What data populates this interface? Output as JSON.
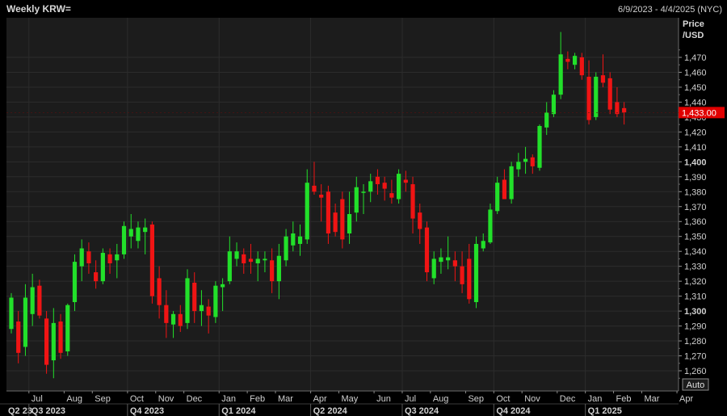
{
  "header": {
    "title": "Weekly KRW=",
    "range": "6/9/2023 - 4/4/2025 (NYC)"
  },
  "axis": {
    "price_label_line1": "Price",
    "price_label_line2": "/USD",
    "auto_label": "Auto"
  },
  "colors": {
    "background": "#000000",
    "plot_bg": "#1c1c1c",
    "up": "#22e02a",
    "down": "#f01414",
    "grid": "#2c2c2c",
    "text": "#d0d0d0",
    "last_badge": "#e00000"
  },
  "chart_data": {
    "type": "candlestick",
    "title": "Weekly KRW=",
    "subtitle": "6/9/2023 - 4/4/2025 (NYC)",
    "ylim": [
      1250,
      1490
    ],
    "y_ticks": [
      1260,
      1270,
      1280,
      1290,
      1300,
      1310,
      1320,
      1330,
      1340,
      1350,
      1360,
      1370,
      1380,
      1390,
      1400,
      1410,
      1420,
      1430,
      1440,
      1450,
      1460,
      1470
    ],
    "y_tick_labels": [
      "1,260",
      "1,270",
      "1,280",
      "1,290",
      "1,300",
      "1,310",
      "1,320",
      "1,330",
      "1,340",
      "1,350",
      "1,360",
      "1,370",
      "1,380",
      "1,390",
      "1,400",
      "1,410",
      "1,420",
      "1,430",
      "1,440",
      "1,450",
      "1,460",
      "1,470"
    ],
    "y_bold_ticks": [
      1300,
      1400
    ],
    "last_price": 1433,
    "last_price_label": "1,433.00",
    "month_labels": [
      {
        "label": "Jul",
        "week": 3
      },
      {
        "label": "Aug",
        "week": 8
      },
      {
        "label": "Sep",
        "week": 12
      },
      {
        "label": "Oct",
        "week": 17
      },
      {
        "label": "Nov",
        "week": 21
      },
      {
        "label": "Dec",
        "week": 25
      },
      {
        "label": "Jan",
        "week": 30
      },
      {
        "label": "Feb",
        "week": 34
      },
      {
        "label": "Mar",
        "week": 38
      },
      {
        "label": "Apr",
        "week": 43
      },
      {
        "label": "May",
        "week": 47
      },
      {
        "label": "Jun",
        "week": 52
      },
      {
        "label": "Jul",
        "week": 56
      },
      {
        "label": "Aug",
        "week": 60
      },
      {
        "label": "Sep",
        "week": 65
      },
      {
        "label": "Oct",
        "week": 69
      },
      {
        "label": "Nov",
        "week": 73
      },
      {
        "label": "Dec",
        "week": 78
      },
      {
        "label": "Jan",
        "week": 82
      },
      {
        "label": "Feb",
        "week": 86
      },
      {
        "label": "Mar",
        "week": 90
      },
      {
        "label": "Apr",
        "week": 95
      }
    ],
    "quarter_labels": [
      {
        "label": "Q2 23",
        "week": -1
      },
      {
        "label": "Q3 2023",
        "week": 3
      },
      {
        "label": "Q4 2023",
        "week": 17
      },
      {
        "label": "Q1 2024",
        "week": 30
      },
      {
        "label": "Q2 2024",
        "week": 43
      },
      {
        "label": "Q3 2024",
        "week": 56
      },
      {
        "label": "Q4 2024",
        "week": 69
      },
      {
        "label": "Q1 2025",
        "week": 82
      }
    ],
    "candles": [
      {
        "o": 1288,
        "h": 1312,
        "l": 1285,
        "c": 1309
      },
      {
        "o": 1293,
        "h": 1300,
        "l": 1265,
        "c": 1272
      },
      {
        "o": 1276,
        "h": 1318,
        "l": 1270,
        "c": 1309
      },
      {
        "o": 1298,
        "h": 1325,
        "l": 1290,
        "c": 1316
      },
      {
        "o": 1317,
        "h": 1321,
        "l": 1295,
        "c": 1297
      },
      {
        "o": 1295,
        "h": 1300,
        "l": 1258,
        "c": 1264
      },
      {
        "o": 1267,
        "h": 1302,
        "l": 1255,
        "c": 1292
      },
      {
        "o": 1293,
        "h": 1298,
        "l": 1268,
        "c": 1272
      },
      {
        "o": 1273,
        "h": 1305,
        "l": 1270,
        "c": 1304
      },
      {
        "o": 1306,
        "h": 1338,
        "l": 1300,
        "c": 1333
      },
      {
        "o": 1330,
        "h": 1348,
        "l": 1320,
        "c": 1342
      },
      {
        "o": 1340,
        "h": 1346,
        "l": 1325,
        "c": 1332
      },
      {
        "o": 1326,
        "h": 1334,
        "l": 1315,
        "c": 1320
      },
      {
        "o": 1320,
        "h": 1342,
        "l": 1318,
        "c": 1339
      },
      {
        "o": 1338,
        "h": 1342,
        "l": 1325,
        "c": 1332
      },
      {
        "o": 1334,
        "h": 1345,
        "l": 1322,
        "c": 1338
      },
      {
        "o": 1338,
        "h": 1360,
        "l": 1335,
        "c": 1357
      },
      {
        "o": 1350,
        "h": 1365,
        "l": 1342,
        "c": 1355
      },
      {
        "o": 1347,
        "h": 1360,
        "l": 1342,
        "c": 1356
      },
      {
        "o": 1353,
        "h": 1362,
        "l": 1338,
        "c": 1356
      },
      {
        "o": 1358,
        "h": 1360,
        "l": 1305,
        "c": 1310
      },
      {
        "o": 1322,
        "h": 1330,
        "l": 1295,
        "c": 1304
      },
      {
        "o": 1304,
        "h": 1314,
        "l": 1282,
        "c": 1292
      },
      {
        "o": 1291,
        "h": 1300,
        "l": 1282,
        "c": 1298
      },
      {
        "o": 1298,
        "h": 1304,
        "l": 1286,
        "c": 1290
      },
      {
        "o": 1292,
        "h": 1328,
        "l": 1288,
        "c": 1322
      },
      {
        "o": 1319,
        "h": 1326,
        "l": 1292,
        "c": 1300
      },
      {
        "o": 1300,
        "h": 1314,
        "l": 1290,
        "c": 1304
      },
      {
        "o": 1303,
        "h": 1308,
        "l": 1285,
        "c": 1297
      },
      {
        "o": 1296,
        "h": 1320,
        "l": 1292,
        "c": 1317
      },
      {
        "o": 1316,
        "h": 1322,
        "l": 1300,
        "c": 1318
      },
      {
        "o": 1320,
        "h": 1350,
        "l": 1318,
        "c": 1340
      },
      {
        "o": 1335,
        "h": 1346,
        "l": 1330,
        "c": 1340
      },
      {
        "o": 1338,
        "h": 1342,
        "l": 1325,
        "c": 1332
      },
      {
        "o": 1335,
        "h": 1345,
        "l": 1325,
        "c": 1333
      },
      {
        "o": 1332,
        "h": 1340,
        "l": 1320,
        "c": 1335
      },
      {
        "o": 1334,
        "h": 1340,
        "l": 1326,
        "c": 1335
      },
      {
        "o": 1334,
        "h": 1342,
        "l": 1312,
        "c": 1320
      },
      {
        "o": 1320,
        "h": 1345,
        "l": 1308,
        "c": 1337
      },
      {
        "o": 1334,
        "h": 1355,
        "l": 1330,
        "c": 1350
      },
      {
        "o": 1344,
        "h": 1360,
        "l": 1340,
        "c": 1352
      },
      {
        "o": 1345,
        "h": 1358,
        "l": 1337,
        "c": 1350
      },
      {
        "o": 1348,
        "h": 1395,
        "l": 1345,
        "c": 1386
      },
      {
        "o": 1384,
        "h": 1400,
        "l": 1378,
        "c": 1380
      },
      {
        "o": 1378,
        "h": 1385,
        "l": 1360,
        "c": 1376
      },
      {
        "o": 1380,
        "h": 1384,
        "l": 1345,
        "c": 1352
      },
      {
        "o": 1366,
        "h": 1372,
        "l": 1350,
        "c": 1353
      },
      {
        "o": 1375,
        "h": 1380,
        "l": 1342,
        "c": 1348
      },
      {
        "o": 1352,
        "h": 1380,
        "l": 1345,
        "c": 1365
      },
      {
        "o": 1366,
        "h": 1390,
        "l": 1360,
        "c": 1383
      },
      {
        "o": 1380,
        "h": 1385,
        "l": 1365,
        "c": 1380
      },
      {
        "o": 1380,
        "h": 1392,
        "l": 1373,
        "c": 1387
      },
      {
        "o": 1390,
        "h": 1395,
        "l": 1378,
        "c": 1385
      },
      {
        "o": 1386,
        "h": 1390,
        "l": 1374,
        "c": 1382
      },
      {
        "o": 1379,
        "h": 1388,
        "l": 1372,
        "c": 1376
      },
      {
        "o": 1375,
        "h": 1395,
        "l": 1372,
        "c": 1392
      },
      {
        "o": 1388,
        "h": 1394,
        "l": 1380,
        "c": 1386
      },
      {
        "o": 1385,
        "h": 1390,
        "l": 1352,
        "c": 1362
      },
      {
        "o": 1366,
        "h": 1372,
        "l": 1345,
        "c": 1355
      },
      {
        "o": 1356,
        "h": 1360,
        "l": 1320,
        "c": 1326
      },
      {
        "o": 1322,
        "h": 1340,
        "l": 1318,
        "c": 1335
      },
      {
        "o": 1333,
        "h": 1342,
        "l": 1325,
        "c": 1336
      },
      {
        "o": 1334,
        "h": 1350,
        "l": 1328,
        "c": 1336
      },
      {
        "o": 1334,
        "h": 1340,
        "l": 1320,
        "c": 1330
      },
      {
        "o": 1330,
        "h": 1340,
        "l": 1312,
        "c": 1318
      },
      {
        "o": 1335,
        "h": 1345,
        "l": 1305,
        "c": 1308
      },
      {
        "o": 1306,
        "h": 1350,
        "l": 1302,
        "c": 1345
      },
      {
        "o": 1342,
        "h": 1352,
        "l": 1340,
        "c": 1347
      },
      {
        "o": 1346,
        "h": 1372,
        "l": 1345,
        "c": 1368
      },
      {
        "o": 1367,
        "h": 1390,
        "l": 1365,
        "c": 1386
      },
      {
        "o": 1388,
        "h": 1395,
        "l": 1380,
        "c": 1375
      },
      {
        "o": 1375,
        "h": 1400,
        "l": 1372,
        "c": 1397
      },
      {
        "o": 1395,
        "h": 1406,
        "l": 1390,
        "c": 1400
      },
      {
        "o": 1400,
        "h": 1410,
        "l": 1392,
        "c": 1402
      },
      {
        "o": 1403,
        "h": 1405,
        "l": 1392,
        "c": 1397
      },
      {
        "o": 1396,
        "h": 1425,
        "l": 1394,
        "c": 1424
      },
      {
        "o": 1423,
        "h": 1440,
        "l": 1418,
        "c": 1433
      },
      {
        "o": 1432,
        "h": 1448,
        "l": 1430,
        "c": 1445
      },
      {
        "o": 1445,
        "h": 1487,
        "l": 1442,
        "c": 1472
      },
      {
        "o": 1469,
        "h": 1474,
        "l": 1462,
        "c": 1467
      },
      {
        "o": 1465,
        "h": 1473,
        "l": 1462,
        "c": 1471
      },
      {
        "o": 1470,
        "h": 1473,
        "l": 1455,
        "c": 1458
      },
      {
        "o": 1457,
        "h": 1468,
        "l": 1425,
        "c": 1428
      },
      {
        "o": 1430,
        "h": 1460,
        "l": 1428,
        "c": 1457
      },
      {
        "o": 1458,
        "h": 1472,
        "l": 1450,
        "c": 1453
      },
      {
        "o": 1456,
        "h": 1460,
        "l": 1432,
        "c": 1435
      },
      {
        "o": 1440,
        "h": 1450,
        "l": 1430,
        "c": 1432
      },
      {
        "o": 1436,
        "h": 1440,
        "l": 1425,
        "c": 1433
      }
    ]
  }
}
